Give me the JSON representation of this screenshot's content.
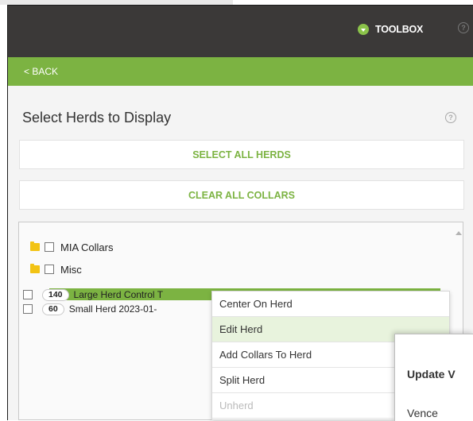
{
  "topbar": {
    "toolbox_label": "TOOLBOX",
    "help_icon": "?"
  },
  "nav": {
    "back_label": "< BACK"
  },
  "section": {
    "title": "Select Herds to Display",
    "help_icon": "?"
  },
  "buttons": {
    "select_all": "SELECT ALL HERDS",
    "clear_all": "CLEAR ALL COLLARS"
  },
  "groups": [
    {
      "label": "MIA Collars",
      "icon": "folder-icon"
    },
    {
      "label": "Misc",
      "icon": "folder-icon"
    }
  ],
  "herds": [
    {
      "count": "140",
      "name": "Large Herd Control T",
      "selected": true
    },
    {
      "count": "60",
      "name": "Small Herd 2023-01-",
      "selected": false
    }
  ],
  "context_menu": {
    "items": [
      {
        "label": "Center On Herd",
        "state": "normal"
      },
      {
        "label": "Edit Herd",
        "state": "hover"
      },
      {
        "label": "Add Collars To Herd",
        "state": "normal"
      },
      {
        "label": "Split Herd",
        "state": "normal"
      },
      {
        "label": "Unherd",
        "state": "disabled"
      }
    ]
  },
  "dialog": {
    "title": "Update V",
    "text": "Vence"
  },
  "colors": {
    "accent": "#7cb342",
    "topbar": "#3b3938",
    "folder": "#f2c314",
    "menu_hover": "#e8f3dd"
  }
}
